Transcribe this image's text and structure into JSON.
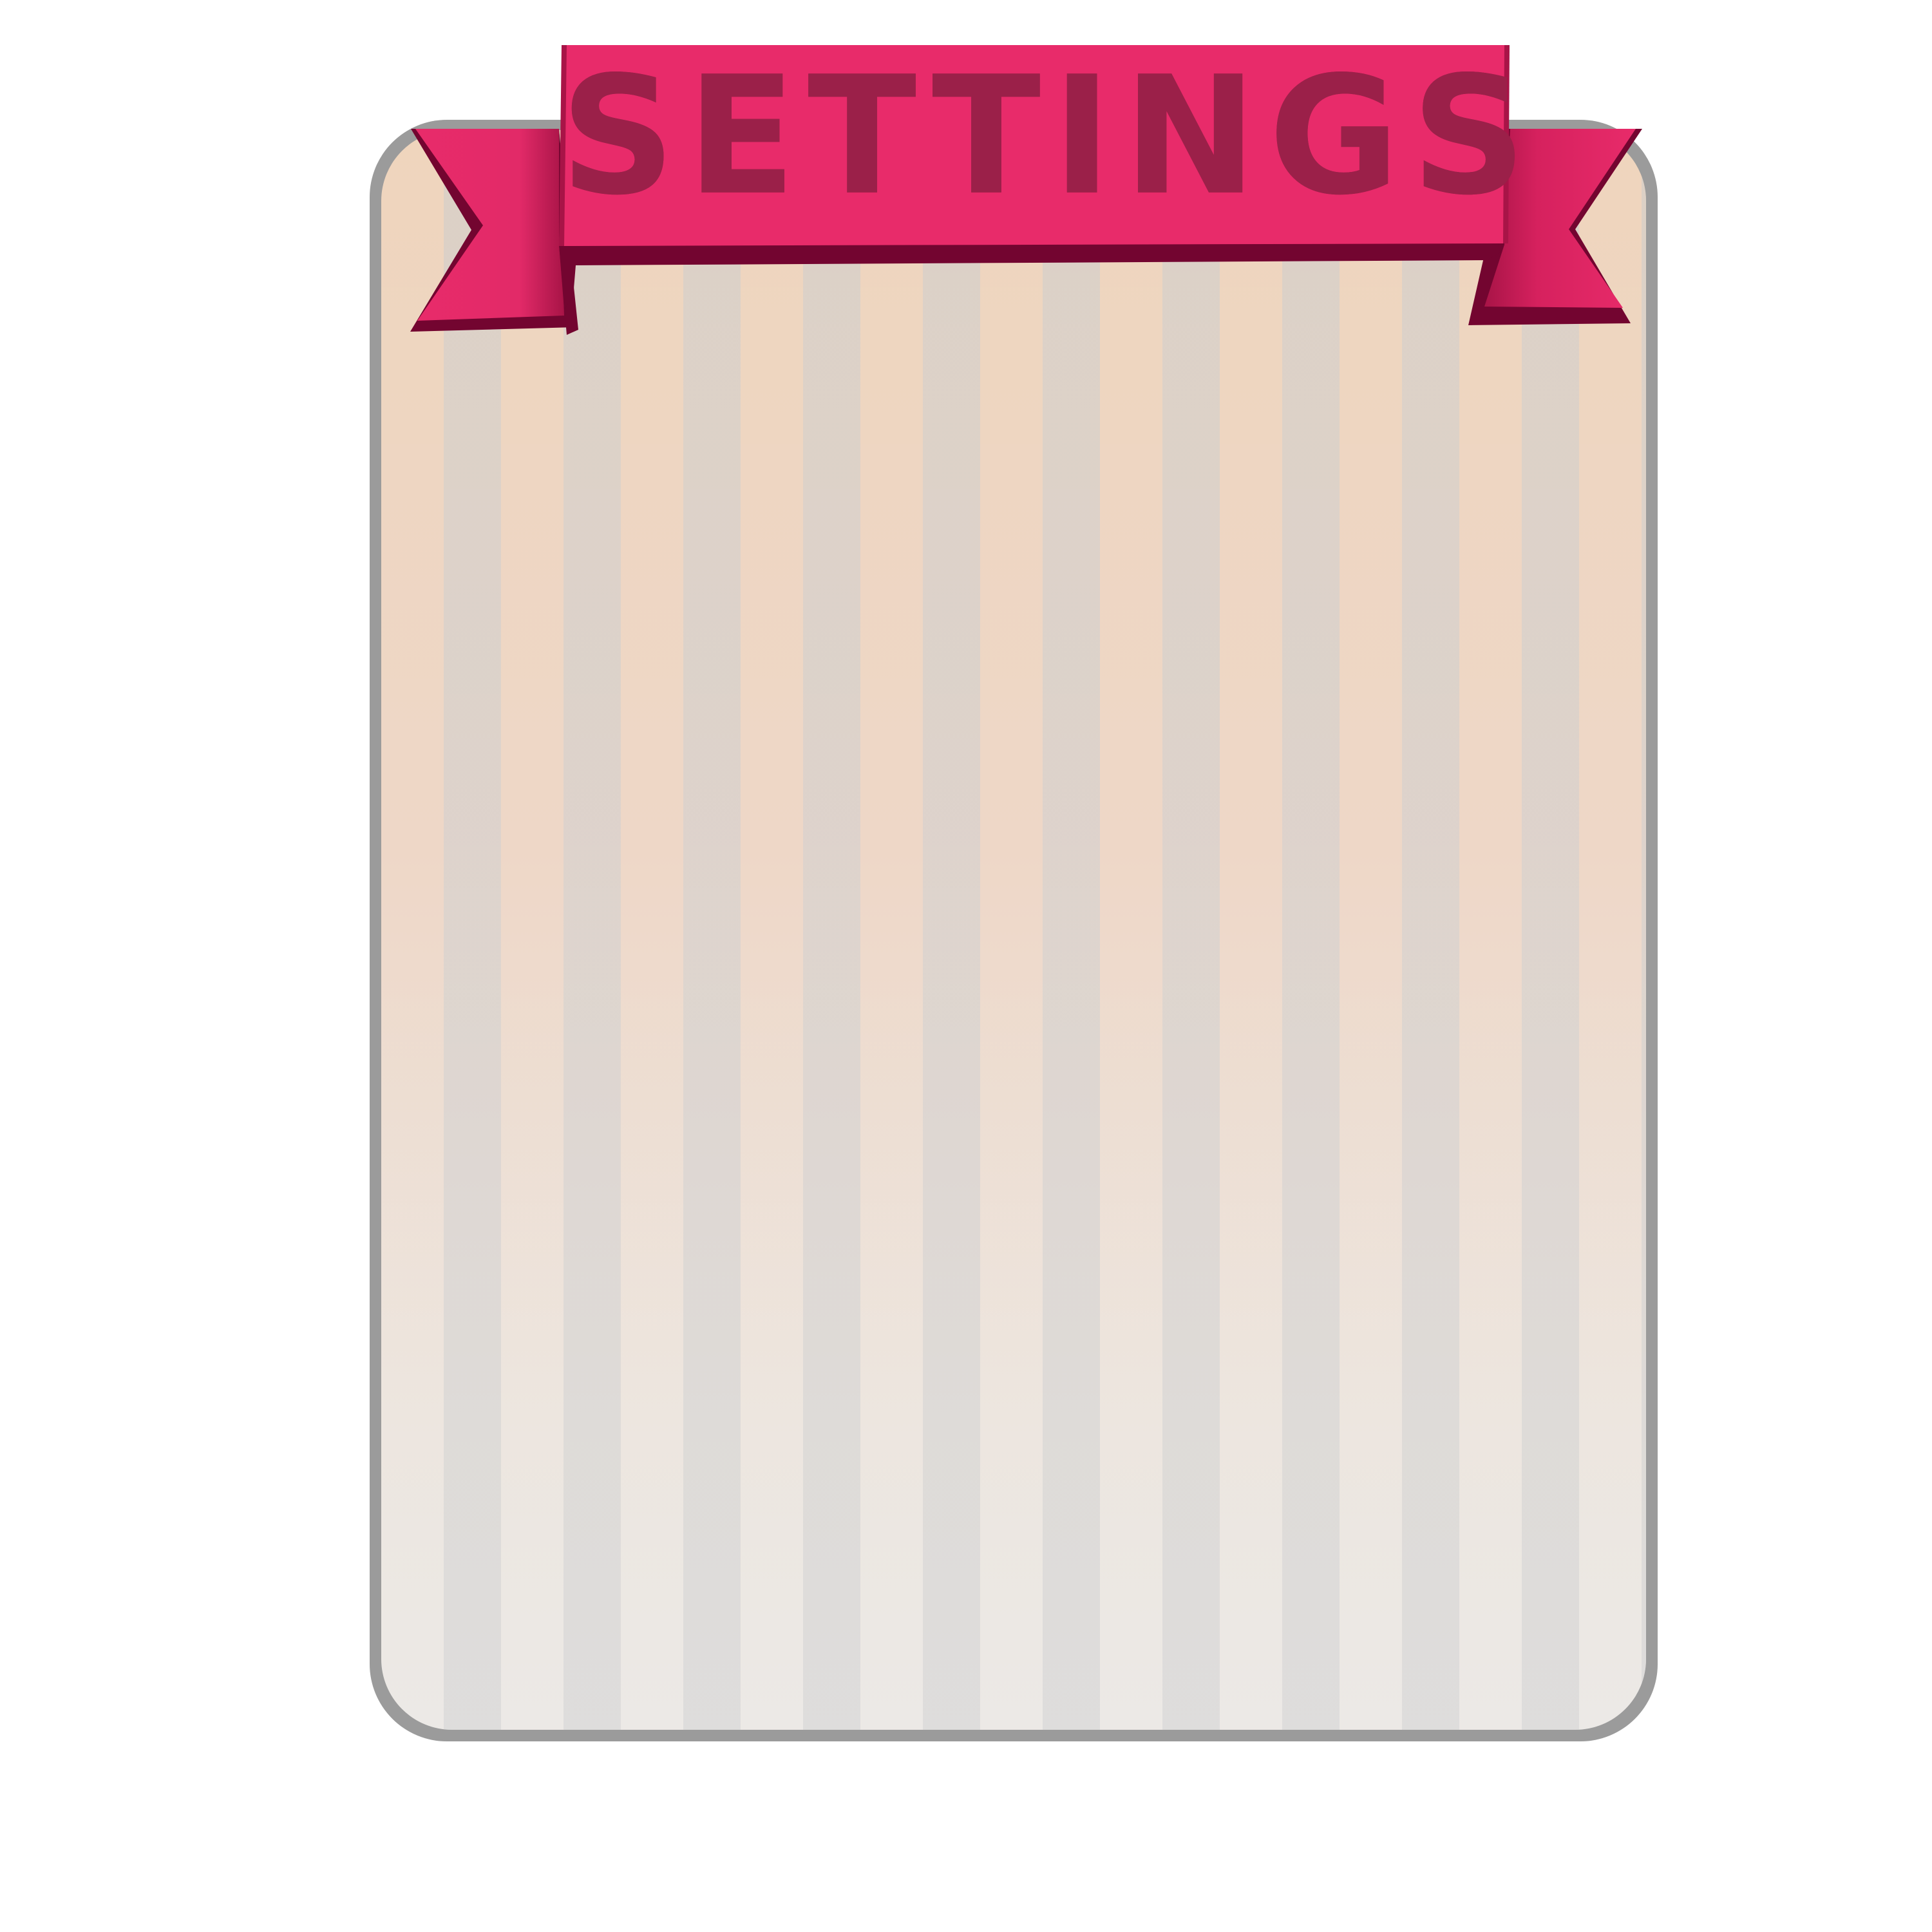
{
  "panel": {
    "title": "SETTINGS"
  },
  "colors": {
    "ribbon_main": "#e82b6a",
    "ribbon_dark": "#730530",
    "title_text": "#9b2049",
    "panel_border": "#9b9b9b",
    "panel_top": "#efd5bd",
    "panel_bottom": "#e9e6e3",
    "stripe": "#d3d3d3"
  }
}
